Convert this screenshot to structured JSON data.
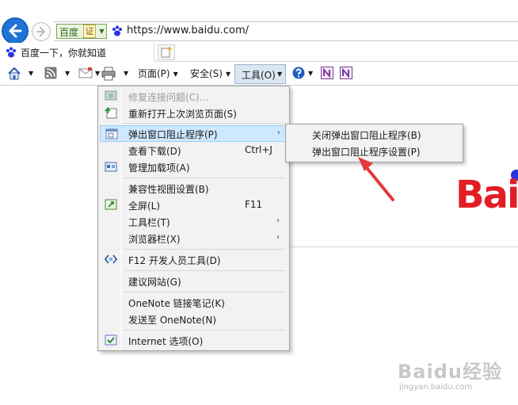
{
  "address_bar": {
    "cert_label": "百度",
    "cert_badge": "证",
    "url": "https://www.baidu.com/"
  },
  "tabs": [
    {
      "title": "百度一下，你就知道"
    }
  ],
  "command_bar": {
    "page": "页面(P)",
    "safety": "安全(S)",
    "tools": "工具(O)"
  },
  "tools_menu": {
    "items": [
      {
        "label": "修复连接问题(C)...",
        "disabled": true,
        "icon": "connection-repair-icon"
      },
      {
        "label": "重新打开上次浏览页面(S)",
        "icon": "reopen-session-icon"
      },
      {
        "label": "弹出窗口阻止程序(P)",
        "submenu": true,
        "highlighted": true,
        "icon": "popup-blocker-icon"
      },
      {
        "label": "查看下载(D)",
        "accel": "Ctrl+J"
      },
      {
        "label": "管理加载项(A)",
        "icon": "addons-icon"
      },
      {
        "label": "兼容性视图设置(B)"
      },
      {
        "label": "全屏(L)",
        "accel": "F11",
        "icon": "fullscreen-icon"
      },
      {
        "label": "工具栏(T)",
        "submenu": true
      },
      {
        "label": "浏览器栏(X)",
        "submenu": true
      },
      {
        "label": "F12 开发人员工具(D)",
        "icon": "developer-tools-icon"
      },
      {
        "label": "建议网站(G)"
      },
      {
        "label": "OneNote 链接笔记(K)"
      },
      {
        "label": "发送至 OneNote(N)"
      },
      {
        "label": "Internet 选项(O)",
        "icon": "internet-options-icon"
      }
    ]
  },
  "popup_submenu": {
    "items": [
      {
        "label": "关闭弹出窗口阻止程序(B)"
      },
      {
        "label": "弹出窗口阻止程序设置(P)"
      }
    ]
  },
  "page": {
    "logo_text": "Bai"
  },
  "watermark": {
    "title": "Baidu经验",
    "subtitle": "jingyan.baidu.com"
  },
  "colors": {
    "accent_blue": "#1f74d6",
    "menu_highlight": "#cde8ff",
    "baidu_red": "#e21d25",
    "annotation_red": "#e5383b"
  }
}
